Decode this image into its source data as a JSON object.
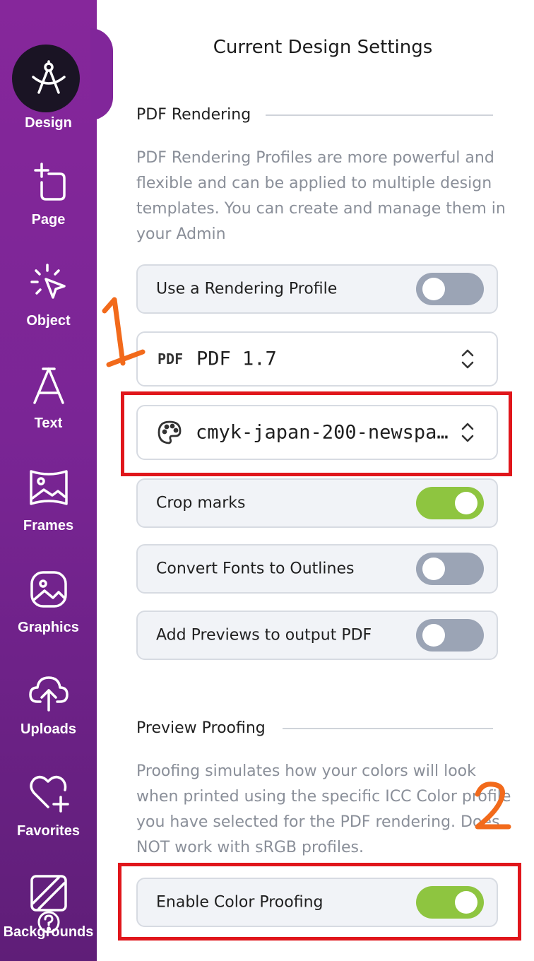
{
  "sidebar": {
    "items": [
      {
        "label": "Design",
        "icon": "compass-icon"
      },
      {
        "label": "Page",
        "icon": "page-icon"
      },
      {
        "label": "Object",
        "icon": "cursor-sparkle-icon"
      },
      {
        "label": "Text",
        "icon": "text-icon"
      },
      {
        "label": "Frames",
        "icon": "frame-image-icon"
      },
      {
        "label": "Graphics",
        "icon": "graphics-icon"
      },
      {
        "label": "Uploads",
        "icon": "cloud-upload-icon"
      },
      {
        "label": "Favorites",
        "icon": "heart-plus-icon"
      },
      {
        "label": "Backgrounds",
        "icon": "background-icon"
      }
    ],
    "help_icon": "question-icon"
  },
  "panel": {
    "title": "Current Design Settings",
    "pdf_section": {
      "heading": "PDF Rendering",
      "description": "PDF Rendering Profiles are more powerful and flexible and can be applied to multiple design templates. You can create and manage them in your Admin",
      "use_profile": {
        "label": "Use a Rendering Profile",
        "on": false
      },
      "pdf_version": {
        "tag": "PDF",
        "value": "PDF 1.7"
      },
      "color_profile": {
        "value": "cmyk-japan-200-newspa…"
      },
      "crop_marks": {
        "label": "Crop marks",
        "on": true
      },
      "convert_fonts": {
        "label": "Convert Fonts to Outlines",
        "on": false
      },
      "add_previews": {
        "label": "Add Previews to output PDF",
        "on": false
      }
    },
    "proof_section": {
      "heading": "Preview Proofing",
      "description": "Proofing simulates how your colors will look when printed using the specific ICC Color profile you have selected for the PDF rendering. Does NOT work with sRGB profiles.",
      "enable_proofing": {
        "label": "Enable Color Proofing",
        "on": true
      }
    }
  },
  "annotations": {
    "one": "1",
    "two": "2"
  },
  "colors": {
    "sidebar": "#7a2595",
    "toggle_on": "#8ec540",
    "toggle_off": "#9ba4b5",
    "highlight": "#e0161b",
    "annotation": "#f26a1b"
  }
}
